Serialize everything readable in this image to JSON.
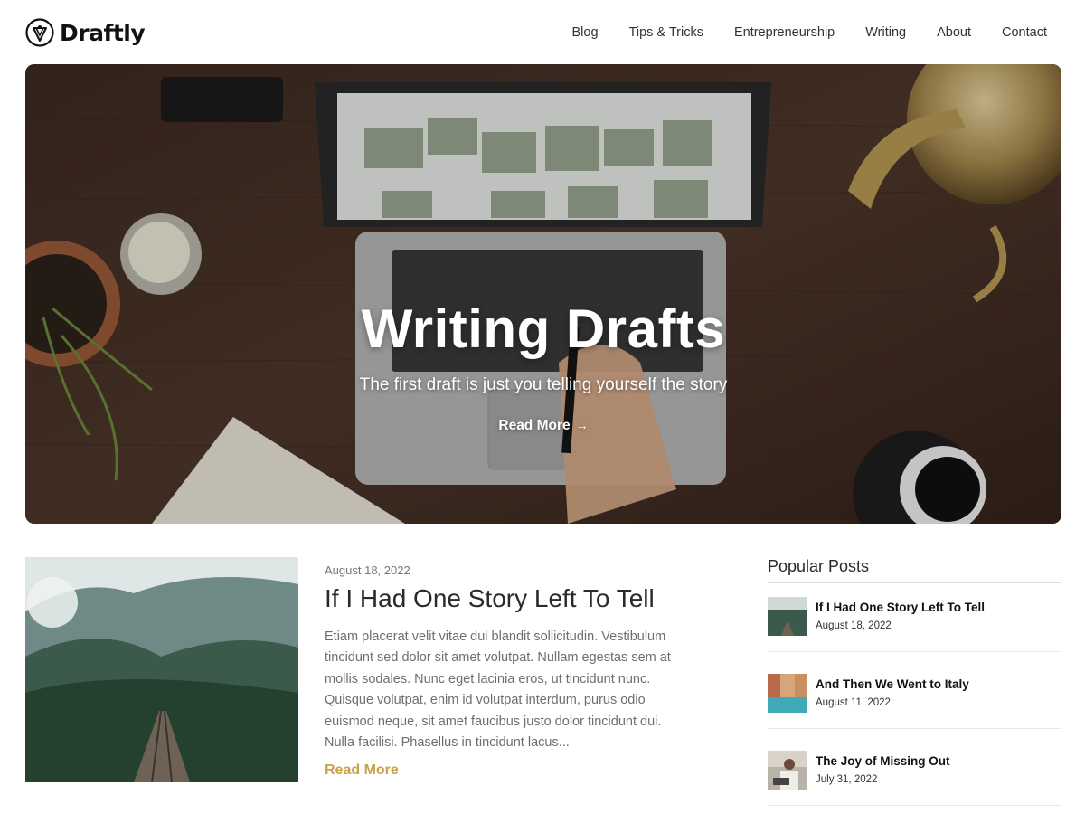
{
  "brand": {
    "name": "Draftly"
  },
  "nav": {
    "items": [
      "Blog",
      "Tips & Tricks",
      "Entrepreneurship",
      "Writing",
      "About",
      "Contact"
    ]
  },
  "hero": {
    "title": "Writing Drafts",
    "subtitle": "The first draft is just you telling yourself the story",
    "read_more": "Read More"
  },
  "featured": {
    "date": "August 18, 2022",
    "title": "If I Had One Story Left To Tell",
    "excerpt": "Etiam placerat velit vitae dui blandit sollicitudin. Vestibulum tincidunt sed dolor sit amet volutpat. Nullam egestas sem at mollis sodales. Nunc eget lacinia eros, ut tincidunt nunc. Quisque volutpat, enim id volutpat interdum, purus odio euismod neque, sit amet faucibus justo dolor tincidunt dui. Nulla facilisi. Phasellus in tincidunt lacus...",
    "read_more": "Read More"
  },
  "sidebar": {
    "title": "Popular Posts",
    "posts": [
      {
        "title": "If I Had One Story Left To Tell",
        "date": "August 18, 2022"
      },
      {
        "title": "And Then We Went to Italy",
        "date": "August 11, 2022"
      },
      {
        "title": "The Joy of Missing Out",
        "date": "July 31, 2022"
      }
    ]
  },
  "colors": {
    "accent": "#c9a24a",
    "text": "#222222",
    "muted": "#6e6e6e"
  }
}
